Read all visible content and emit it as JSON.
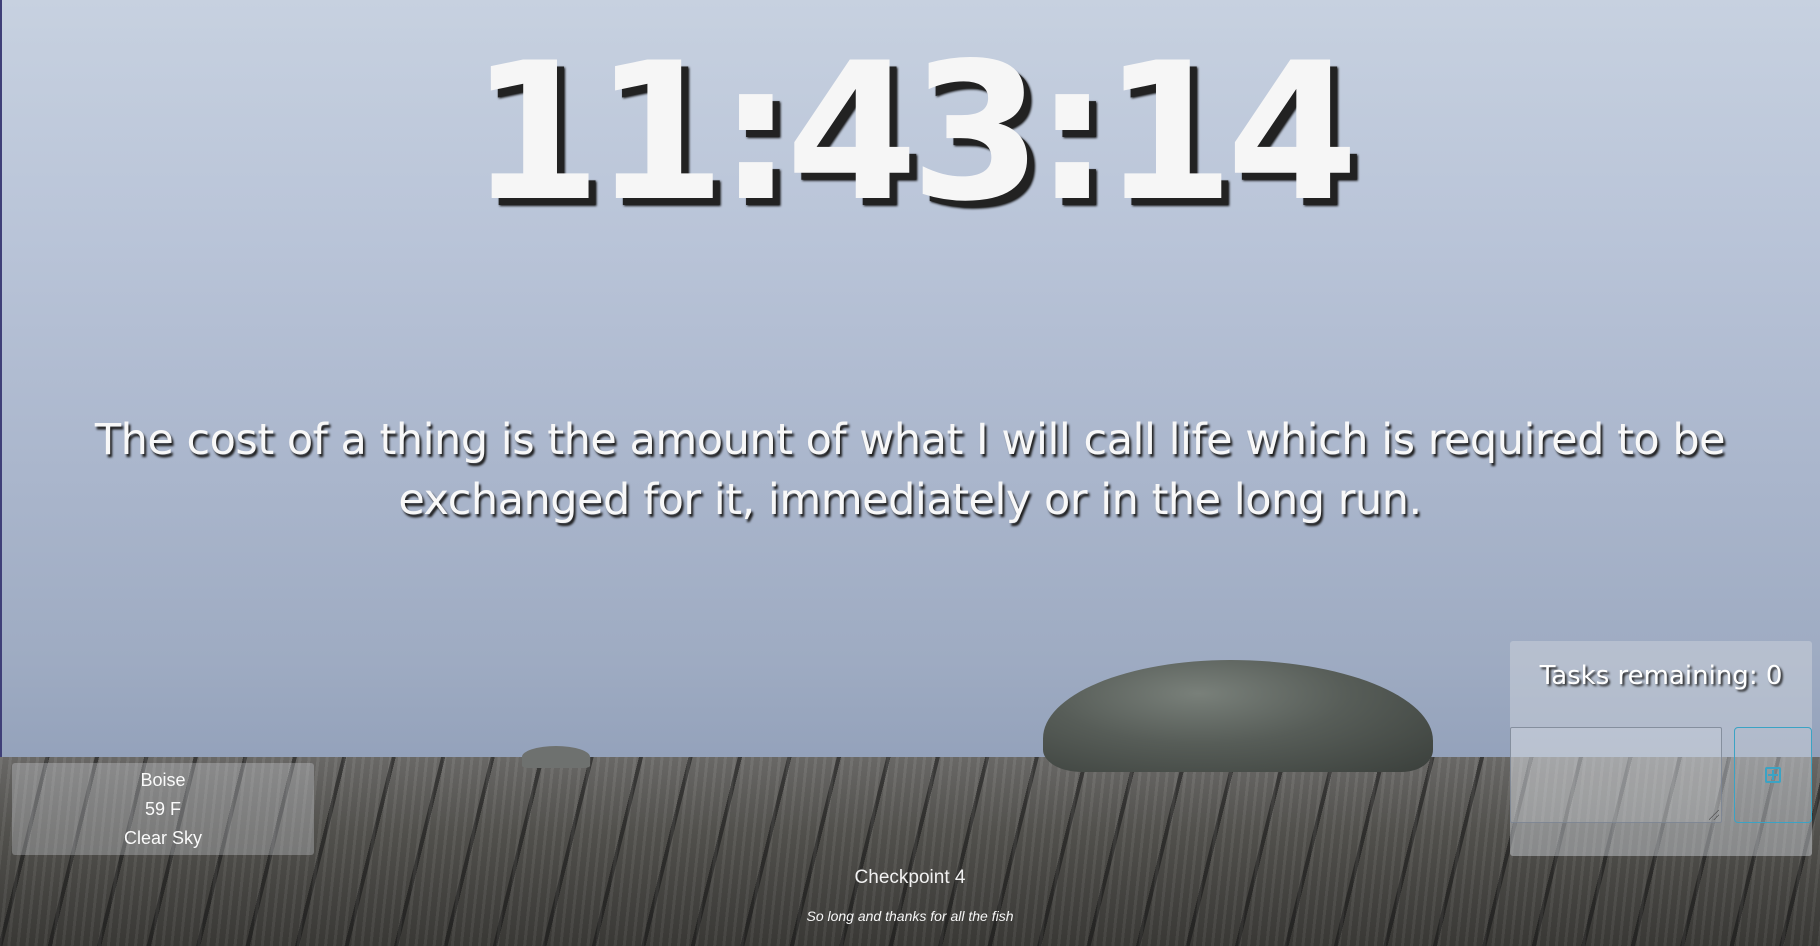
{
  "clock": {
    "time": "11:43:14"
  },
  "quote": {
    "text": "The cost of a thing is the amount of what I will call life which is required to be exchanged for it, immediately or in the long run."
  },
  "weather": {
    "city": "Boise",
    "temperature": "59 F",
    "condition": "Clear Sky"
  },
  "tasks": {
    "title": "Tasks remaining: 0",
    "input_value": "",
    "add_icon": "plus-square-icon"
  },
  "footer": {
    "checkpoint": "Checkpoint 4",
    "tagline": "So long and thanks for all the fish"
  },
  "colors": {
    "accent": "#3ba3c4",
    "text": "#ffffff"
  }
}
